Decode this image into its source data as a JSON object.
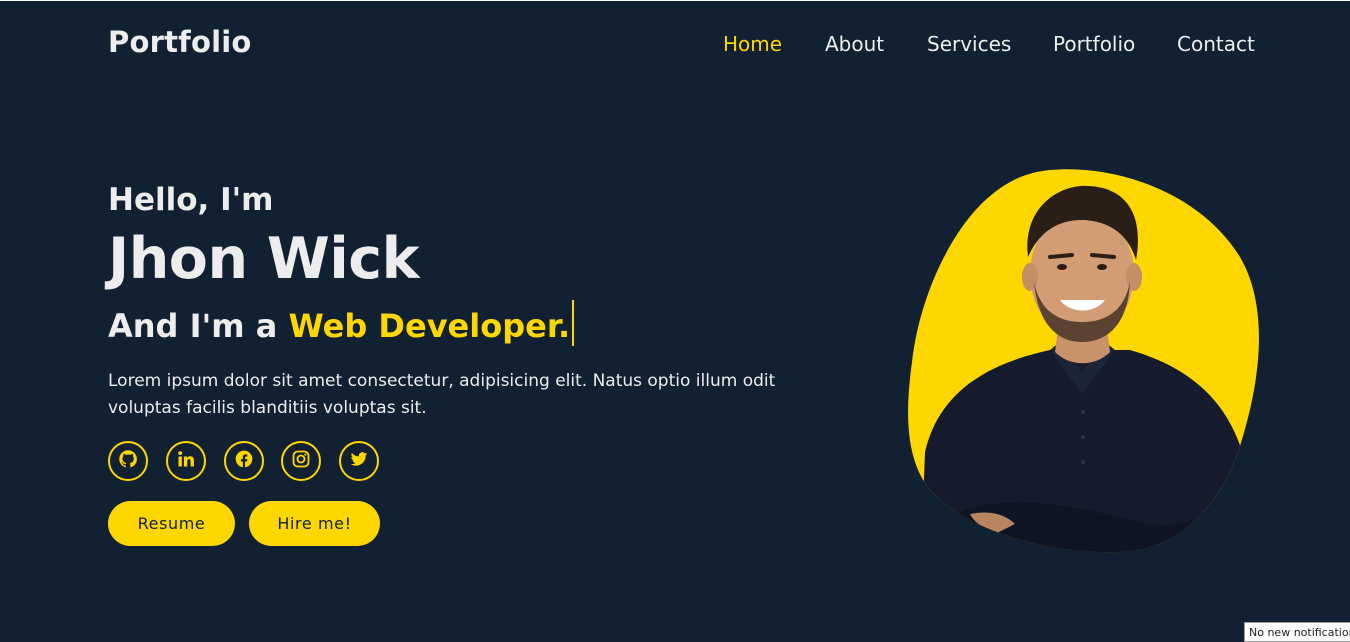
{
  "header": {
    "logo": "Portfolio",
    "nav": [
      {
        "label": "Home",
        "active": true
      },
      {
        "label": "About",
        "active": false
      },
      {
        "label": "Services",
        "active": false
      },
      {
        "label": "Portfolio",
        "active": false
      },
      {
        "label": "Contact",
        "active": false
      }
    ]
  },
  "hero": {
    "greeting": "Hello, I'm",
    "name": "Jhon Wick",
    "role_prefix": "And I'm a",
    "role_highlight": "Web Developer.",
    "description": "Lorem ipsum dolor sit amet consectetur, adipisicing elit. Natus optio illum odit voluptas facilis blanditiis voluptas sit.",
    "social_icons": [
      "github-icon",
      "linkedin-icon",
      "facebook-icon",
      "instagram-icon",
      "twitter-icon"
    ],
    "buttons": {
      "resume": "Resume",
      "hire": "Hire me!"
    }
  },
  "notification": "No new notifications",
  "colors": {
    "background": "#112131",
    "accent": "#ffd700",
    "text": "#ededed"
  }
}
